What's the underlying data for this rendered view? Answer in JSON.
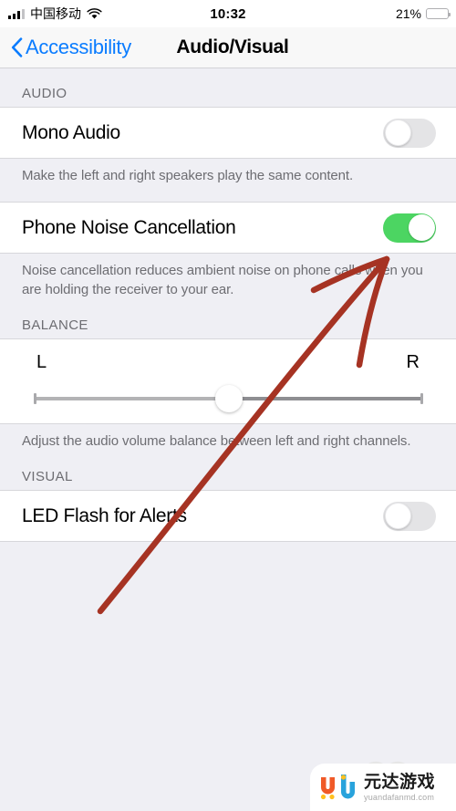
{
  "status_bar": {
    "carrier": "中国移动",
    "time": "10:32",
    "battery_percent_label": "21%",
    "battery_level": 21,
    "signal_bars_filled": 3,
    "signal_bars_total": 4,
    "icons": {
      "signal": "cellular-signal-icon",
      "wifi": "wifi-icon",
      "battery": "battery-icon"
    },
    "colors": {
      "battery_fill": "#FECB2E",
      "bar_active": "#000000",
      "bar_inactive": "#C3C3C6"
    }
  },
  "nav_bar": {
    "back_label": "Accessibility",
    "back_icon": "chevron-left-icon",
    "title": "Audio/Visual",
    "back_color": "#0A7CFF"
  },
  "sections": [
    {
      "header": "AUDIO",
      "rows": [
        {
          "label": "Mono Audio",
          "control": "switch",
          "value": "off"
        }
      ],
      "footer": "Make the left and right speakers play the same content."
    },
    {
      "header": "",
      "rows": [
        {
          "label": "Phone Noise Cancellation",
          "control": "switch",
          "value": "on"
        }
      ],
      "footer": "Noise cancellation reduces ambient noise on phone calls when you are holding the receiver to your ear."
    },
    {
      "header": "BALANCE",
      "rows": [
        {
          "control": "slider",
          "left_label": "L",
          "right_label": "R",
          "value": 50,
          "min": 0,
          "max": 100
        }
      ],
      "footer": "Adjust the audio volume balance between left and right channels."
    },
    {
      "header": "VISUAL",
      "rows": [
        {
          "label": "LED Flash for Alerts",
          "control": "switch",
          "value": "off"
        }
      ],
      "footer": ""
    }
  ],
  "annotation": {
    "type": "hand-drawn-arrow",
    "color": "#A63323",
    "points_to": "Phone Noise Cancellation switch"
  },
  "watermark": {
    "brand_cn": "元达游戏",
    "url": "yuandafanmd.com",
    "colors": {
      "orange": "#F05A28",
      "blue": "#29A3DC",
      "yellow": "#FFC01E"
    }
  },
  "theme": {
    "switch_on": "#4CD562",
    "switch_off": "#E4E4E6",
    "group_background": "#EFEFF4",
    "cell_background": "#FFFFFF",
    "secondary_text": "#6D6D72"
  }
}
